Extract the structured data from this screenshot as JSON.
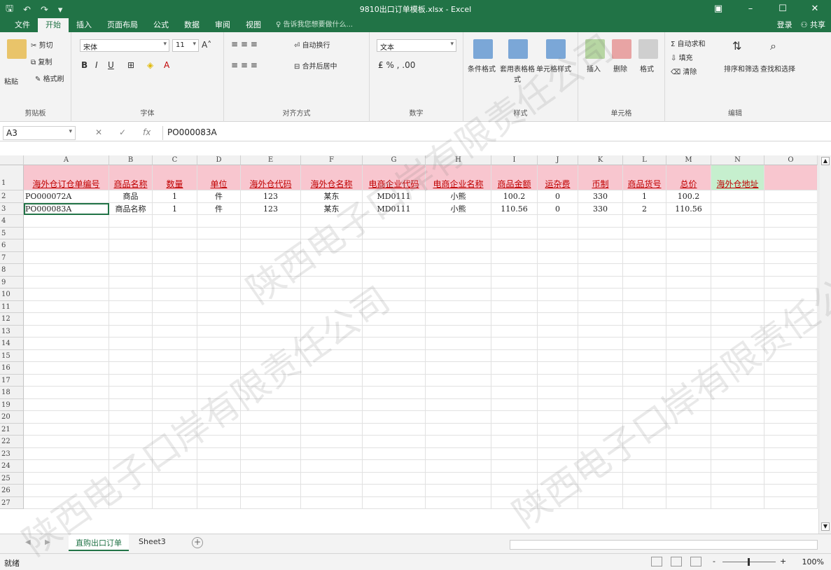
{
  "window": {
    "title": "9810出口订单模板.xlsx - Excel"
  },
  "ribbon_tabs": [
    "文件",
    "开始",
    "插入",
    "页面布局",
    "公式",
    "数据",
    "审阅",
    "视图"
  ],
  "tell_me": "告诉我您想要做什么...",
  "account": {
    "login": "登录",
    "share": "共享"
  },
  "ribbon": {
    "clipboard": {
      "paste": "粘贴",
      "cut": "剪切",
      "copy": "复制",
      "format_painter": "格式刷",
      "label": "剪贴板"
    },
    "font": {
      "name": "宋体",
      "size": "11",
      "label": "字体"
    },
    "alignment": {
      "wrap": "自动换行",
      "merge": "合并后居中",
      "label": "对齐方式"
    },
    "number": {
      "format": "文本",
      "label": "数字"
    },
    "styles": {
      "conditional": "条件格式",
      "table": "套用表格格式",
      "cell": "单元格样式",
      "label": "样式"
    },
    "cells": {
      "insert": "插入",
      "delete": "删除",
      "format": "格式",
      "label": "单元格"
    },
    "editing": {
      "autosum": "自动求和",
      "fill": "填充",
      "clear": "清除",
      "sort": "排序和筛选",
      "find": "查找和选择",
      "label": "编辑"
    }
  },
  "formula_bar": {
    "name_box": "A3",
    "value": "PO000083A"
  },
  "columns": [
    "A",
    "B",
    "C",
    "D",
    "E",
    "F",
    "G",
    "H",
    "I",
    "J",
    "K",
    "L",
    "M",
    "N",
    "O"
  ],
  "headers": [
    "海外仓订仓单编号",
    "商品名称",
    "数量",
    "单位",
    "海外仓代码",
    "海外仓名称",
    "电商企业代码",
    "电商企业名称",
    "商品金额",
    "运杂费",
    "币制",
    "商品货号",
    "总价",
    "海外仓地址"
  ],
  "rows": [
    [
      "PO000072A",
      "商品",
      "1",
      "件",
      "123",
      "某东",
      "MD0111",
      "小熊",
      "100.2",
      "0",
      "330",
      "1",
      "100.2",
      ""
    ],
    [
      "PO000083A",
      "商品名称",
      "1",
      "件",
      "123",
      "某东",
      "MD0111",
      "小熊",
      "110.56",
      "0",
      "330",
      "2",
      "110.56",
      ""
    ]
  ],
  "row_numbers": [
    "1",
    "2",
    "3",
    "4",
    "5",
    "6",
    "7",
    "8",
    "9",
    "10",
    "11",
    "12",
    "13",
    "14",
    "15",
    "16",
    "17",
    "18",
    "19",
    "20",
    "21",
    "22",
    "23",
    "24",
    "25",
    "26",
    "27"
  ],
  "sheets": [
    "直购出口订单",
    "Sheet3"
  ],
  "status": {
    "text": "就绪",
    "zoom": "100%"
  },
  "watermark": "陕西电子口岸有限责任公司",
  "colors": {
    "excel_green": "#217346",
    "header_pink": "#f8c6cf",
    "header_green": "#c6efce",
    "header_text": "#c00000"
  }
}
